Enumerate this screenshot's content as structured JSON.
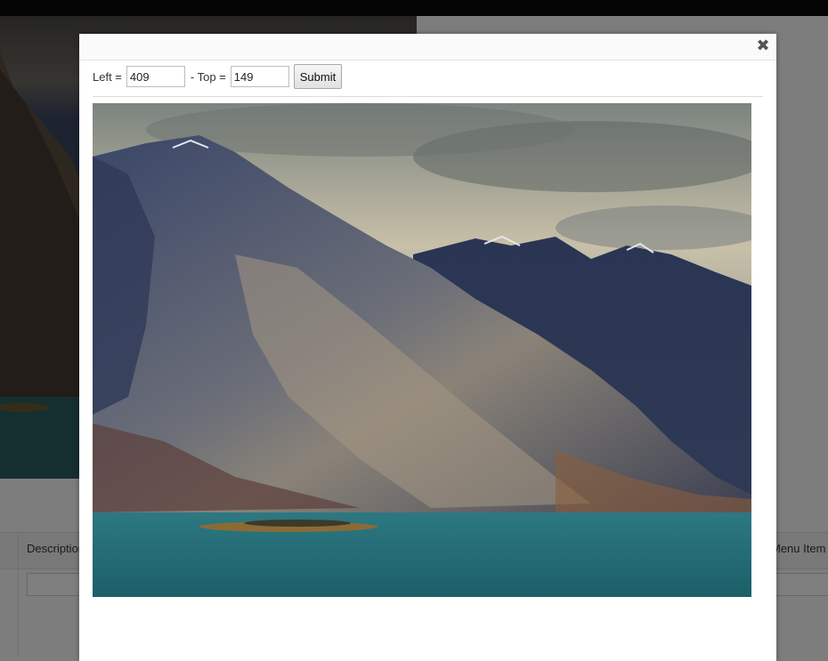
{
  "background_page": {
    "table_headers": [
      "Description",
      "Menu Item"
    ]
  },
  "modal": {
    "close_glyph": "✖",
    "left_label": "Left =",
    "left_value": "409",
    "top_label": "- Top =",
    "top_value": "149",
    "submit_label": "Submit",
    "image_description": "mountain-lake-photo"
  },
  "colors": {
    "overlay": "#000000",
    "modal_header": "#fafafa",
    "water": "#1f6a74",
    "mountain": "#2d3a5c"
  }
}
